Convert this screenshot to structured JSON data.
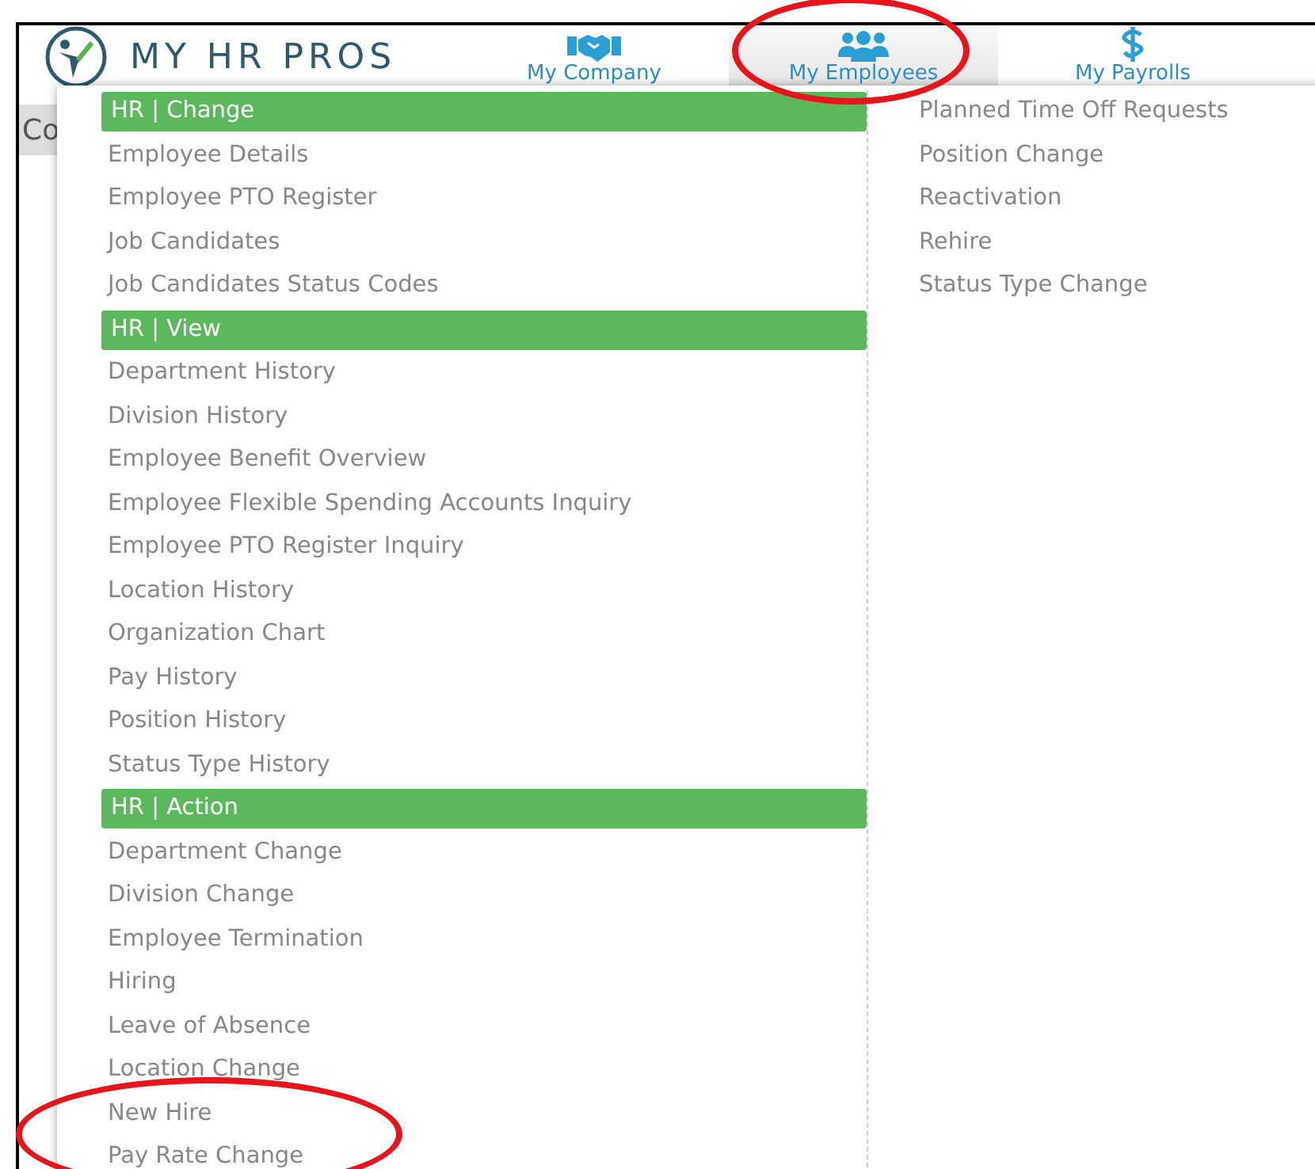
{
  "header": {
    "logo_text": "MY HR PROS"
  },
  "nav": [
    {
      "label": "My Company",
      "selected": false
    },
    {
      "label": "My Employees",
      "selected": true
    },
    {
      "label": "My Payrolls",
      "selected": false
    }
  ],
  "background": {
    "fragments": [
      {
        "text": "Co",
        "kind": "bar"
      }
    ]
  },
  "menu": {
    "sections": [
      {
        "title": "HR | Change",
        "items": [
          "Employee Details",
          "Employee PTO Register",
          "Job Candidates",
          "Job Candidates Status Codes"
        ]
      },
      {
        "title": "HR | View",
        "items": [
          "Department History",
          "Division History",
          "Employee Benefit Overview",
          "Employee Flexible Spending Accounts Inquiry",
          "Employee PTO Register Inquiry",
          "Location History",
          "Organization Chart",
          "Pay History",
          "Position History",
          "Status Type History"
        ]
      },
      {
        "title": "HR | Action",
        "items": [
          "Department Change",
          "Division Change",
          "Employee Termination",
          "Hiring",
          "Leave of Absence",
          "Location Change",
          "New Hire",
          "Pay Rate Change"
        ]
      }
    ],
    "right_items": [
      "Planned Time Off Requests",
      "Position Change",
      "Reactivation",
      "Rehire",
      "Status Type Change"
    ]
  },
  "annotations": [
    {
      "kind": "ellipse"
    },
    {
      "kind": "ellipse"
    }
  ]
}
